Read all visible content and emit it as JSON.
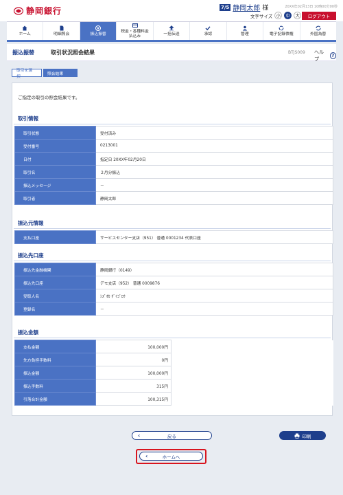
{
  "header": {
    "bank_name": "静岡銀行",
    "user_badge": "7/5",
    "user_name": "静岡太郎",
    "user_suffix": "様",
    "last_login": "20XX年02月13日 10時00分00秒",
    "font_size_label": "文字サイズ",
    "font_sizes": [
      "小",
      "中",
      "大"
    ],
    "font_size_selected": "中",
    "logout_label": "ログアウト"
  },
  "global_nav": [
    {
      "label": "ホーム",
      "icon": "home-icon"
    },
    {
      "label": "明細照会",
      "icon": "document-icon"
    },
    {
      "label": "振込振替",
      "icon": "yen-transfer-icon",
      "active": true
    },
    {
      "label": "税金・各種料金\n払込み",
      "icon": "bill-icon"
    },
    {
      "label": "一括伝送",
      "icon": "upload-icon"
    },
    {
      "label": "承認",
      "icon": "check-icon"
    },
    {
      "label": "管理",
      "icon": "user-icon"
    },
    {
      "label": "電子記録債権",
      "icon": "refresh-icon"
    },
    {
      "label": "外国為替",
      "icon": "exchange-icon"
    }
  ],
  "page": {
    "category": "振込振替",
    "title": "取引状況照会結果",
    "screen_id": "BTJS009",
    "help_label": "ヘルプ",
    "help_icon": "?"
  },
  "steps": [
    "取引を選択",
    "照会結果"
  ],
  "intro": "ご指定の取引の照会結果です。",
  "sections": {
    "transaction": {
      "title": "取引情報",
      "rows": [
        {
          "label": "取引状態",
          "value": "受付済み"
        },
        {
          "label": "受付番号",
          "value": "0213001"
        },
        {
          "label": "日付",
          "value": "指定日 20XX年02月20日"
        },
        {
          "label": "取引名",
          "value": "２月分振込"
        },
        {
          "label": "振込メッセージ",
          "value": "－"
        },
        {
          "label": "取引者",
          "value": "静岡太郎"
        }
      ]
    },
    "source": {
      "title": "振込元情報",
      "rows": [
        {
          "label": "支払口座",
          "value": "サービスセンター支店（951） 普通 0001234 代表口座"
        }
      ]
    },
    "destination": {
      "title": "振込先口座",
      "rows": [
        {
          "label": "振込先金融機関",
          "value": "静岡銀行（0149）"
        },
        {
          "label": "振込先口座",
          "value": "デモ支店（952） 普通 0009876"
        },
        {
          "label": "受取人名",
          "value": "ｼｽﾞｵｶ ﾀﾞｲｺﾞﾛｳ"
        },
        {
          "label": "登録名",
          "value": "－"
        }
      ]
    },
    "amount": {
      "title": "振込金額",
      "rows": [
        {
          "label": "支払金額",
          "value": "100,000円"
        },
        {
          "label": "先方負担手数料",
          "value": "0円"
        },
        {
          "label": "振込金額",
          "value": "100,000円"
        },
        {
          "label": "振込手数料",
          "value": "315円"
        },
        {
          "label": "引落合計金額",
          "value": "100,315円"
        }
      ]
    }
  },
  "buttons": {
    "back": "戻る",
    "print": "印刷",
    "home": "ホームへ"
  },
  "colors": {
    "accent": "#1e3f8c",
    "nav_active": "#4a72c4",
    "brand_red": "#c8102e",
    "highlight": "#d8141e"
  }
}
